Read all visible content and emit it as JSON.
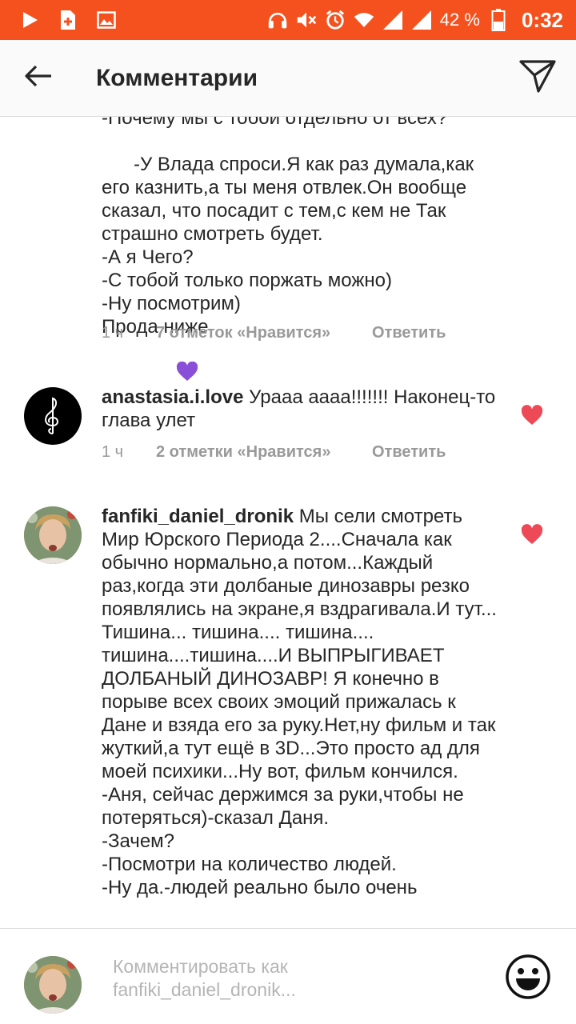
{
  "status_bar": {
    "battery_percent": "42 %",
    "time": "0:32",
    "icons": [
      "play-icon",
      "add-box-icon",
      "image-icon",
      "headset-icon",
      "volume-mute-icon",
      "alarm-icon",
      "wifi-icon",
      "signal-icon",
      "signal-icon",
      "battery-icon"
    ]
  },
  "header": {
    "title": "Комментарии",
    "back_icon": "arrow-left-icon",
    "send_icon": "send-icon"
  },
  "comments": [
    {
      "partial_first_line": "-Почему мы с тобой отдельно от всех?",
      "text": "-У Влада спроси.Я как раз думала,как его казнить,а ты меня отвлек.Он вообще сказал, что посадит с тем,с кем не Так страшно смотреть будет.\n-А я Чего?\n-С тобой только поржать можно)\n-Ну посмотрим)\nПрода ниже",
      "emoji": "purple-heart-icon",
      "time": "1 ч",
      "likes": "7 отметок «Нравится»",
      "reply": "Ответить"
    },
    {
      "username": "anastasia.i.love",
      "text": " Урааа аааа!!!!!!! Наконец-то глава улет",
      "time": "1 ч",
      "likes": "2 отметки «Нравится»",
      "reply": "Ответить",
      "avatar_icon": "treble-clef-icon"
    },
    {
      "username": "fanfiki_daniel_dronik",
      "text": " Мы сели смотреть Мир Юрского Периода 2....Сначала как обычно нормально,а потом...Каждый раз,когда эти долбаные динозавры резко появлялись на экране,я вздрагивала.И тут... Тишина... тишина.... тишина.... тишина....тишина....И ВЫПРЫГИВАЕТ ДОЛБАНЫЙ ДИНОЗАВР! Я конечно в порыве всех своих эмоций прижалась к Дане и взяда его за руку.Нет,ну фильм и так жуткий,а тут ещё в 3D...Это просто ад для моей психики...Ну вот, фильм кончился.\n-Аня, сейчас держимся за руки,чтобы не потеряться)-сказал Даня.\n-Зачем?\n-Посмотри на количество людей.\n-Ну да.-людей реально было очень"
    }
  ],
  "footer": {
    "placeholder_line1": "Комментировать как",
    "placeholder_line2": "fanfiki_daniel_dronik...",
    "emoji_icon": "smiley-face-icon"
  },
  "colors": {
    "status_bar": "#f4511e",
    "heart": "#ed4956",
    "purple_heart": "#8a4fd8",
    "meta_text": "#999999"
  }
}
